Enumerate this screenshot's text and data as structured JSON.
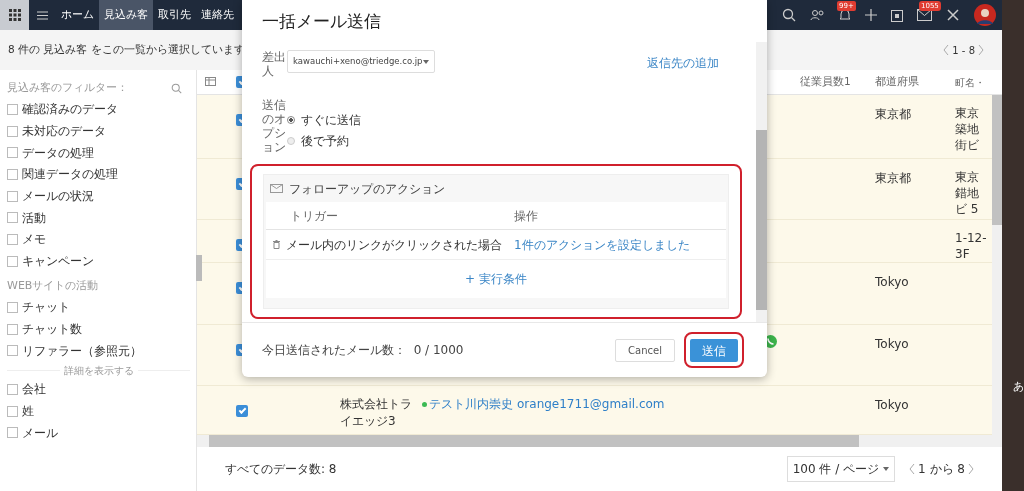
{
  "top_nav": {
    "tabs": [
      {
        "label": "ホーム",
        "selected": false
      },
      {
        "label": "見込み客",
        "selected": true
      },
      {
        "label": "取引先",
        "selected": false
      },
      {
        "label": "連絡先",
        "selected": false
      }
    ],
    "notification_badge": "99+",
    "mail_badge": "1055"
  },
  "sub_header": {
    "selection_text": "8 件の 見込み客 をこの一覧から選択しています",
    "pager": "1 - 8"
  },
  "sidebar": {
    "filter_title": "見込み客のフィルター：",
    "filters": [
      {
        "label": "確認済みのデータ",
        "checked": false
      },
      {
        "label": "未対応のデータ",
        "checked": false
      },
      {
        "label": "データの処理",
        "checked": false
      },
      {
        "label": "関連データの処理",
        "checked": false
      },
      {
        "label": "メールの状況",
        "checked": false
      },
      {
        "label": "活動",
        "checked": false
      },
      {
        "label": "メモ",
        "checked": false
      },
      {
        "label": "キャンペーン",
        "checked": false
      }
    ],
    "web_section": "WEBサイトの活動",
    "web_filters": [
      {
        "label": "チャット",
        "checked": false
      },
      {
        "label": "チャット数",
        "checked": false
      },
      {
        "label": "リファラー（参照元）",
        "checked": false
      }
    ],
    "show_more": "詳細を表示する",
    "field_filters": [
      {
        "label": "会社",
        "checked": false
      },
      {
        "label": "姓",
        "checked": false
      },
      {
        "label": "メール",
        "checked": false
      }
    ]
  },
  "table": {
    "header_checked": true,
    "columns": [
      "従業員数1",
      "都道府県",
      "町名・"
    ],
    "rows": [
      {
        "checked": true,
        "company": "",
        "name": "",
        "email": "",
        "phone": false,
        "prefecture": "東京都",
        "town": [
          "東京",
          "築地",
          "街ビ"
        ]
      },
      {
        "checked": true,
        "company": "",
        "name": "",
        "email": "",
        "phone": false,
        "prefecture": "東京都",
        "town": [
          "東京",
          "錯地",
          "ビ 5"
        ]
      },
      {
        "checked": true,
        "company": "",
        "name": "",
        "email": "",
        "phone": false,
        "prefecture": "",
        "town": [
          "1-12-",
          "3F"
        ]
      },
      {
        "checked": true,
        "company": "",
        "name": "",
        "email": "",
        "phone": false,
        "prefecture": "Tokyo",
        "town": []
      },
      {
        "checked": true,
        "company": "",
        "name": "",
        "email": "",
        "phone": true,
        "prefecture": "Tokyo",
        "town": []
      },
      {
        "checked": true,
        "company": "株式会社トライエッジ3",
        "name": "テスト川内崇史",
        "email": "orange1711@gmail.com",
        "phone": false,
        "prefecture": "Tokyo",
        "town": []
      }
    ],
    "total": "すべてのデータ数: 8",
    "per_page": "100 件 / ページ",
    "pager": "1 から 8"
  },
  "side_strip": "あ",
  "modal": {
    "title": "一括メール送信",
    "from_label": "差出人",
    "from_value": "kawauchi+xeno@triedge.co.jp",
    "reply_link": "返信先の追加",
    "send_option_label": "送信のオプション",
    "send_options": [
      {
        "label": "すぐに送信",
        "selected": true
      },
      {
        "label": "後で予約",
        "selected": false
      }
    ],
    "followup": {
      "title": "フォローアップのアクション",
      "columns": [
        "トリガー",
        "操作"
      ],
      "rows": [
        {
          "trigger": "メール内のリンクがクリックされた場合",
          "action": "1件のアクションを設定しました"
        }
      ],
      "add_condition": "+ 実行条件"
    },
    "sent_today": "今日送信されたメール数：  0 / 1000",
    "cancel": "Cancel",
    "send": "送信"
  }
}
